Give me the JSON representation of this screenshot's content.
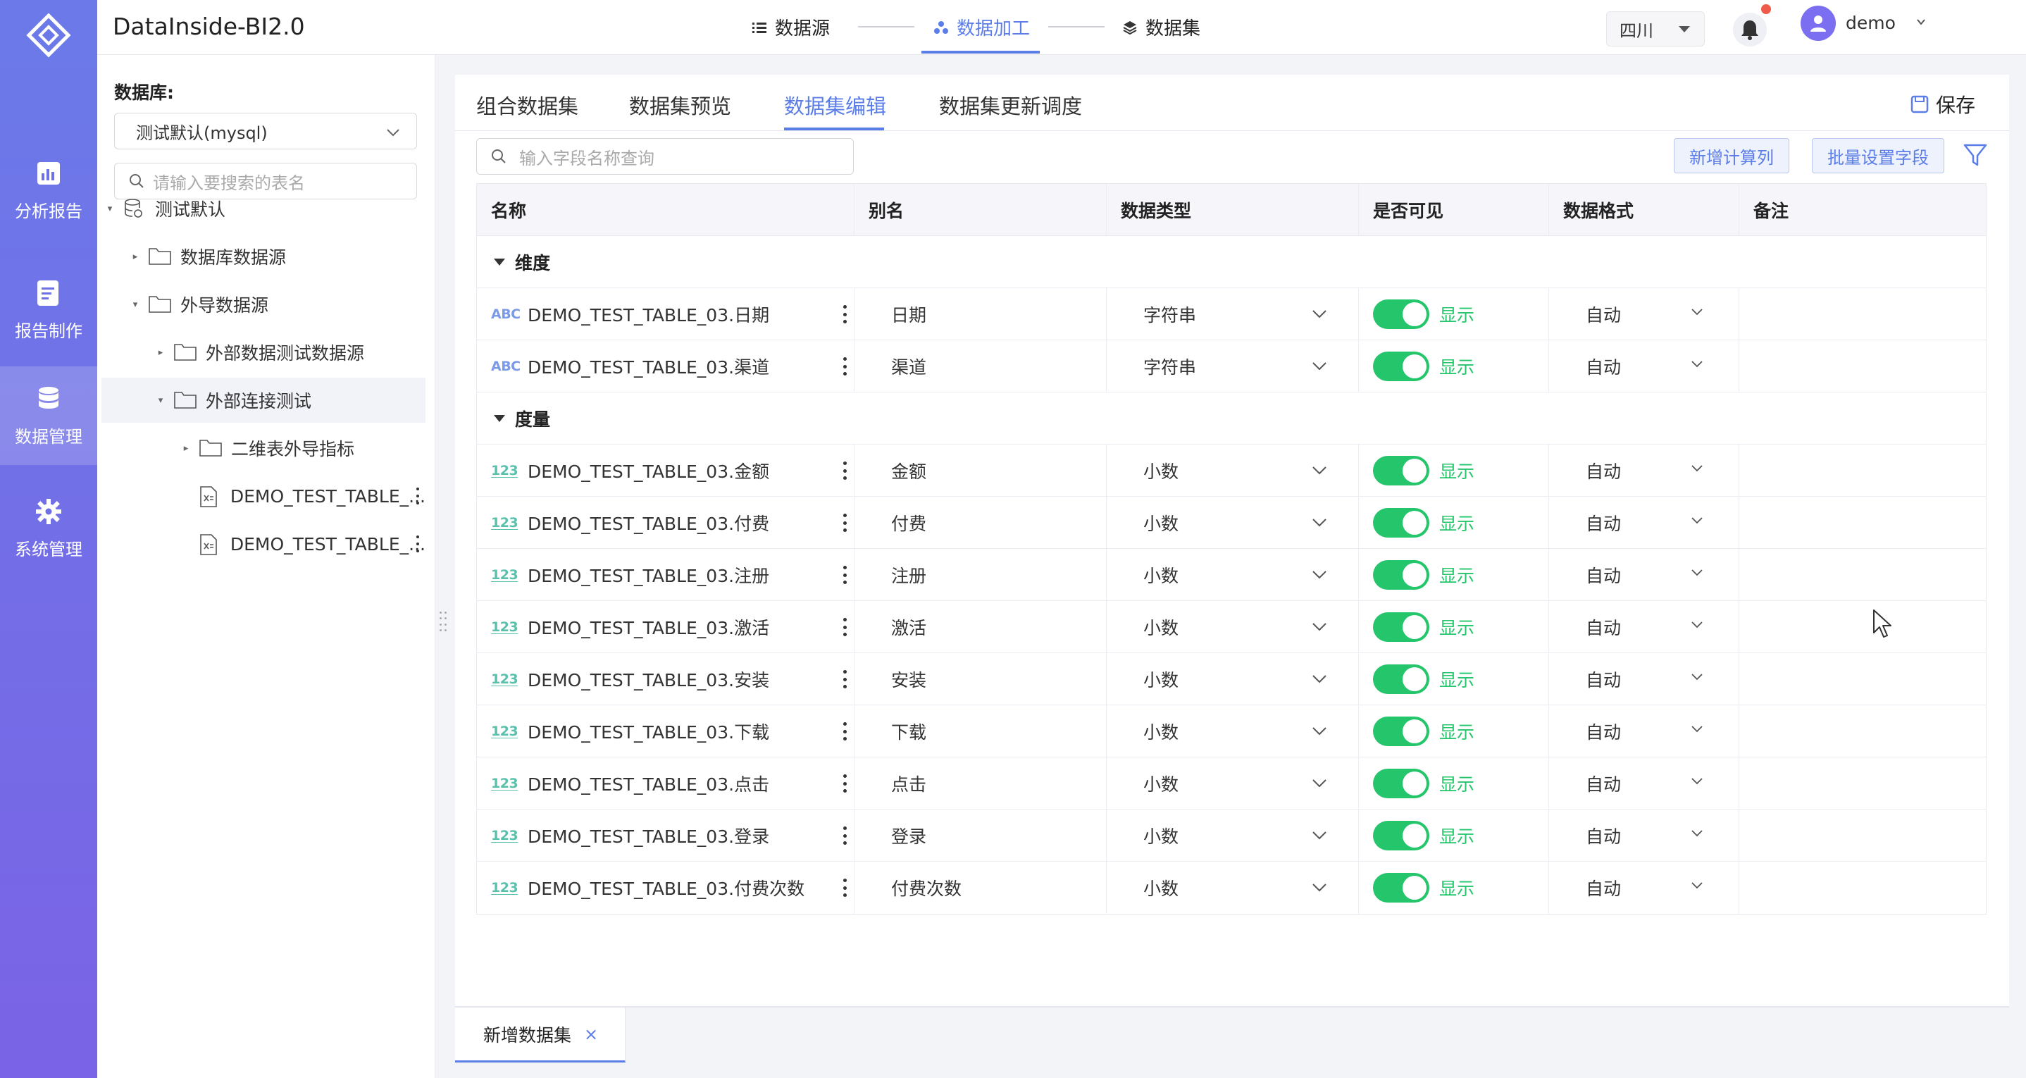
{
  "app": {
    "title": "DataInside-BI2.0"
  },
  "rail": [
    {
      "label": "分析报告",
      "icon": "analysis-report-icon"
    },
    {
      "label": "报告制作",
      "icon": "report-edit-icon"
    },
    {
      "label": "数据管理",
      "icon": "database-icon",
      "active": true
    },
    {
      "label": "系统管理",
      "icon": "gear-icon"
    }
  ],
  "steps": [
    {
      "label": "数据源",
      "icon": "list-icon"
    },
    {
      "label": "数据加工",
      "icon": "cluster-icon",
      "active": true
    },
    {
      "label": "数据集",
      "icon": "layers-icon"
    }
  ],
  "header": {
    "region": "四川",
    "user": "demo"
  },
  "left": {
    "db_label": "数据库:",
    "db_value": "测试默认(mysql)",
    "search_placeholder": "请输入要搜索的表名",
    "tree": [
      {
        "label": "测试默认",
        "kind": "db",
        "level": 0,
        "expanded": true
      },
      {
        "label": "数据库数据源",
        "kind": "folder",
        "level": 1,
        "expanded": false
      },
      {
        "label": "外导数据源",
        "kind": "folder",
        "level": 1,
        "expanded": true
      },
      {
        "label": "外部数据测试数据源",
        "kind": "folder",
        "level": 2,
        "expanded": false
      },
      {
        "label": "外部连接测试",
        "kind": "folder",
        "level": 2,
        "expanded": true,
        "selected": true
      },
      {
        "label": "二维表外导指标",
        "kind": "folder",
        "level": 3,
        "expanded": false
      },
      {
        "label": "DEMO_TEST_TABLE_...",
        "kind": "file",
        "level": 3
      },
      {
        "label": "DEMO_TEST_TABLE_...",
        "kind": "file",
        "level": 3
      }
    ]
  },
  "main": {
    "tabs": [
      "组合数据集",
      "数据集预览",
      "数据集编辑",
      "数据集更新调度"
    ],
    "active_tab": 2,
    "save_label": "保存",
    "field_search_placeholder": "输入字段名称查询",
    "btn_add_calc": "新增计算列",
    "btn_batch": "批量设置字段",
    "columns": [
      "名称",
      "别名",
      "数据类型",
      "是否可见",
      "数据格式",
      "备注"
    ],
    "groups": [
      {
        "name": "维度",
        "rows": [
          {
            "badge": "ABC",
            "name": "DEMO_TEST_TABLE_03.日期",
            "alias": "日期",
            "type": "字符串",
            "visible": "显示",
            "format": "自动",
            "note": ""
          },
          {
            "badge": "ABC",
            "name": "DEMO_TEST_TABLE_03.渠道",
            "alias": "渠道",
            "type": "字符串",
            "visible": "显示",
            "format": "自动",
            "note": ""
          }
        ]
      },
      {
        "name": "度量",
        "rows": [
          {
            "badge": "123",
            "name": "DEMO_TEST_TABLE_03.金额",
            "alias": "金额",
            "type": "小数",
            "visible": "显示",
            "format": "自动",
            "note": ""
          },
          {
            "badge": "123",
            "name": "DEMO_TEST_TABLE_03.付费",
            "alias": "付费",
            "type": "小数",
            "visible": "显示",
            "format": "自动",
            "note": ""
          },
          {
            "badge": "123",
            "name": "DEMO_TEST_TABLE_03.注册",
            "alias": "注册",
            "type": "小数",
            "visible": "显示",
            "format": "自动",
            "note": ""
          },
          {
            "badge": "123",
            "name": "DEMO_TEST_TABLE_03.激活",
            "alias": "激活",
            "type": "小数",
            "visible": "显示",
            "format": "自动",
            "note": ""
          },
          {
            "badge": "123",
            "name": "DEMO_TEST_TABLE_03.安装",
            "alias": "安装",
            "type": "小数",
            "visible": "显示",
            "format": "自动",
            "note": ""
          },
          {
            "badge": "123",
            "name": "DEMO_TEST_TABLE_03.下载",
            "alias": "下载",
            "type": "小数",
            "visible": "显示",
            "format": "自动",
            "note": ""
          },
          {
            "badge": "123",
            "name": "DEMO_TEST_TABLE_03.点击",
            "alias": "点击",
            "type": "小数",
            "visible": "显示",
            "format": "自动",
            "note": ""
          },
          {
            "badge": "123",
            "name": "DEMO_TEST_TABLE_03.登录",
            "alias": "登录",
            "type": "小数",
            "visible": "显示",
            "format": "自动",
            "note": ""
          },
          {
            "badge": "123",
            "name": "DEMO_TEST_TABLE_03.付费次数",
            "alias": "付费次数",
            "type": "小数",
            "visible": "显示",
            "format": "自动",
            "note": ""
          }
        ]
      }
    ]
  },
  "bottom_tab": {
    "label": "新增数据集",
    "close": "×"
  },
  "colors": {
    "accent": "#5b7de8",
    "toggle_on": "#24c56b",
    "rail_top": "#6b7ae8",
    "rail_bottom": "#7a63e6"
  }
}
